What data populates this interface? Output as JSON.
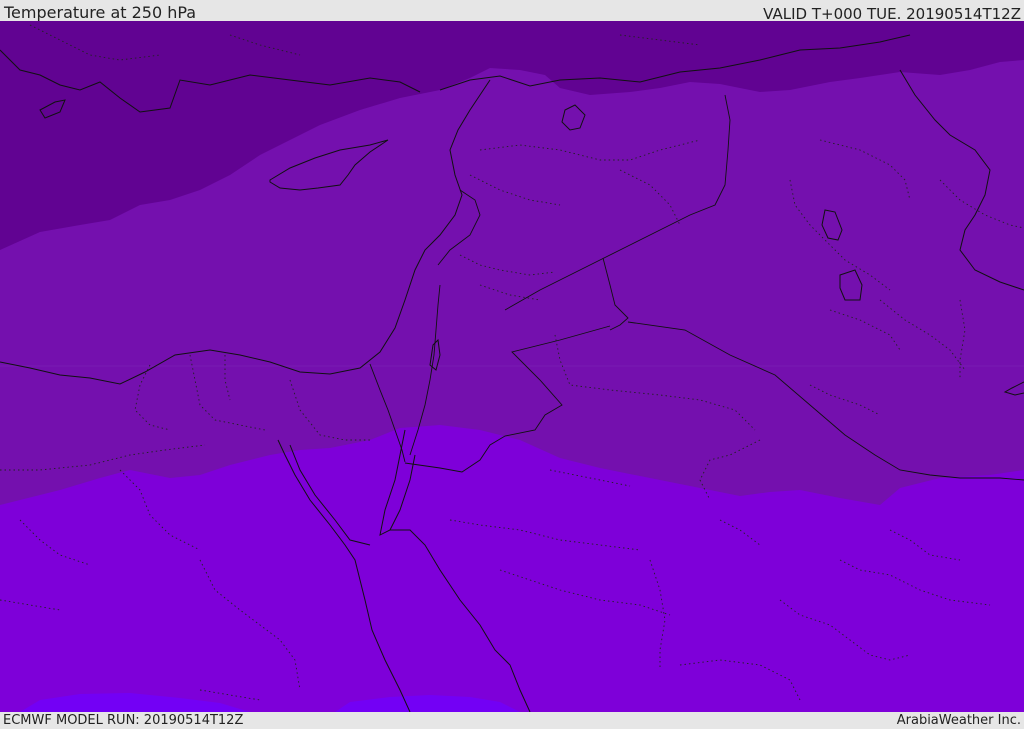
{
  "header": {
    "title": "Temperature at 250 hPa",
    "valid": "VALID T+000 TUE. 20190514T12Z"
  },
  "footer": {
    "model_run": "ECMWF MODEL RUN: 20190514T12Z",
    "credit": "ArabiaWeather Inc."
  },
  "map": {
    "colors": {
      "band_coldest": "#610392",
      "band_cold": "#7410ae",
      "band_cool": "#7e00d9",
      "band_warmer": "#7300f5",
      "coastline": "#111111",
      "borders": "#111111"
    }
  }
}
